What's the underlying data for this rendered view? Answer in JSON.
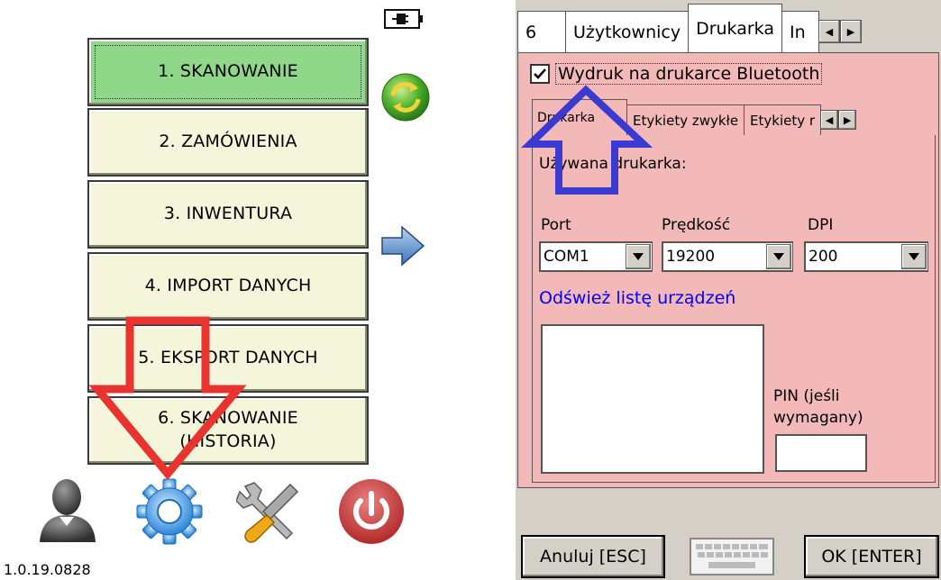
{
  "left": {
    "menu": [
      {
        "label": "1. SKANOWANIE"
      },
      {
        "label": "2. ZAMÓWIENIA"
      },
      {
        "label": "3. INWENTURA"
      },
      {
        "label": "4. IMPORT DANYCH"
      },
      {
        "label": "5. EKSPORT DANYCH"
      },
      {
        "line1": "6. SKANOWANIE",
        "line2": "(HISTORIA)"
      }
    ],
    "version": "1.0.19.0828"
  },
  "right": {
    "top_tabs": [
      "6",
      "Użytkownicy",
      "Drukarka",
      "In"
    ],
    "bluetooth_checkbox": {
      "label": "Wydruk na drukarce Bluetooth",
      "checked": true
    },
    "sub_tabs": [
      "Drukarka",
      "Etykiety zwykłe",
      "Etykiety r"
    ],
    "used_printer_label": "Używana drukarka:",
    "fields": {
      "port": {
        "label": "Port",
        "value": "COM1"
      },
      "speed": {
        "label": "Prędkość",
        "value": "19200"
      },
      "dpi": {
        "label": "DPI",
        "value": "200"
      }
    },
    "refresh_link": "Odśwież listę urządzeń",
    "pin_label_1": "PIN (jeśli",
    "pin_label_2": "wymagany)",
    "cancel_button": "Anuluj [ESC]",
    "ok_button": "OK [ENTER]"
  },
  "colors": {
    "menu_button": "#f5f5dc",
    "menu_button_active": "#8fd88a",
    "settings_panel": "#f3b8b8",
    "highlight_arrow_red": "#e8332f",
    "highlight_arrow_blue": "#3a3ad0",
    "link_blue": "#0000ff"
  },
  "icons": [
    "battery-icon",
    "sync-icon",
    "right-arrow-icon",
    "user-icon",
    "settings-gear-icon",
    "tools-icon",
    "power-icon",
    "keyboard-icon",
    "checkmark-icon"
  ]
}
